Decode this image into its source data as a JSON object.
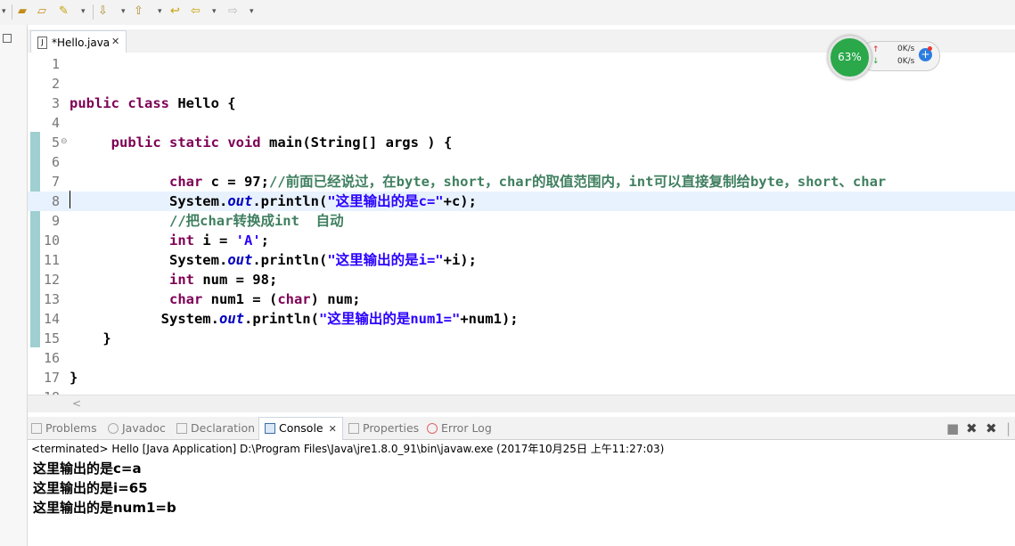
{
  "editor": {
    "tab_title": "*Hello.java",
    "tab_close": "✕",
    "lines": [
      {
        "n": "1",
        "html": ""
      },
      {
        "n": "2",
        "html": ""
      },
      {
        "n": "3",
        "html": "<span class=\"kw\">public class</span> Hello {"
      },
      {
        "n": "4",
        "html": ""
      },
      {
        "n": "5",
        "html": "     <span class=\"kw\">public static void</span> main(String[] args ) {"
      },
      {
        "n": "6",
        "html": ""
      },
      {
        "n": "7",
        "html": "            <span class=\"kw\">char</span> c = 97;<span class=\"cmt\">//前面已经说过，在byte，short，char的取值范围内，int可以直接复制给byte，short、char</span>"
      },
      {
        "n": "8",
        "html": "            System.<span class=\"fld\">out</span>.println(<span class=\"str\">\"这里输出的是c=\"</span>+c);"
      },
      {
        "n": "9",
        "html": "            <span class=\"cmt\">//把char转换成int  自动</span>"
      },
      {
        "n": "10",
        "html": "            <span class=\"kw\">int</span> i = <span class=\"str\">'A'</span>;"
      },
      {
        "n": "11",
        "html": "            System.<span class=\"fld\">out</span>.println(<span class=\"str\">\"这里输出的是i=\"</span>+i);"
      },
      {
        "n": "12",
        "html": "            <span class=\"kw\">int</span> num = 98;"
      },
      {
        "n": "13",
        "html": "            <span class=\"kw\">char</span> num1 = (<span class=\"kw\">char</span>) num;"
      },
      {
        "n": "14",
        "html": "           System.<span class=\"fld\">out</span>.println(<span class=\"str\">\"这里输出的是num1=\"</span>+num1);"
      },
      {
        "n": "15",
        "html": "    }"
      },
      {
        "n": "16",
        "html": ""
      },
      {
        "n": "17",
        "html": "}"
      }
    ],
    "partial_line_number": "18",
    "scroll_left_arrow": "<"
  },
  "widget": {
    "percent": "63%",
    "upload_rate": "0K/s",
    "download_rate": "0K/s",
    "up_arrow": "↑",
    "down_arrow": "↓",
    "plus": "+"
  },
  "console": {
    "tabs": [
      {
        "label": "Problems",
        "active": false
      },
      {
        "label": "Javadoc",
        "active": false
      },
      {
        "label": "Declaration",
        "active": false
      },
      {
        "label": "Console",
        "active": true
      },
      {
        "label": "Properties",
        "active": false
      },
      {
        "label": "Error Log",
        "active": false
      }
    ],
    "status": "<terminated> Hello [Java Application] D:\\Program Files\\Java\\jre1.8.0_91\\bin\\javaw.exe (2017年10月25日 上午11:27:03)",
    "output": [
      "这里输出的是c=a",
      "这里输出的是i=65",
      "这里输出的是num1=b"
    ]
  }
}
